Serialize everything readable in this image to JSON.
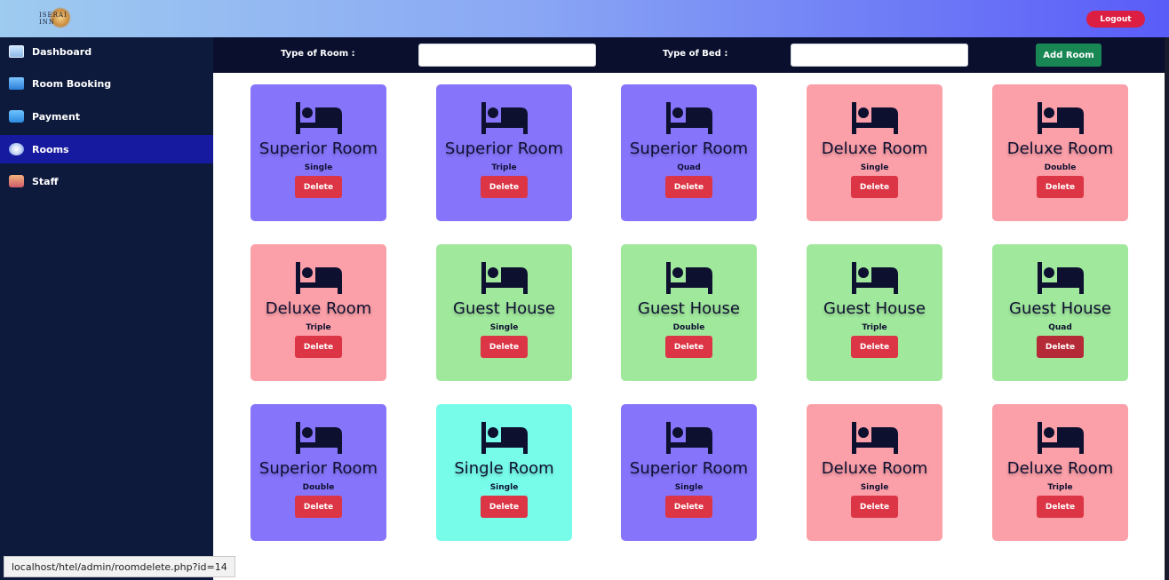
{
  "header": {
    "logo_text": "ISERAI INN",
    "logout_label": "Logout"
  },
  "sidebar": {
    "items": [
      {
        "label": "Dashboard",
        "icon": "monitor-icon"
      },
      {
        "label": "Room Booking",
        "icon": "laptop-icon"
      },
      {
        "label": "Payment",
        "icon": "card-icon"
      },
      {
        "label": "Rooms",
        "icon": "globe-icon",
        "active": true
      },
      {
        "label": "Staff",
        "icon": "people-icon"
      }
    ]
  },
  "filter": {
    "room_type_label": "Type of Room :",
    "room_type_value": "",
    "bed_type_label": "Type of Bed :",
    "bed_type_value": "",
    "add_label": "Add Room"
  },
  "rooms": [
    {
      "name": "Superior Room",
      "bed": "Single",
      "color": "#8675fb"
    },
    {
      "name": "Superior Room",
      "bed": "Triple",
      "color": "#8675fb"
    },
    {
      "name": "Superior Room",
      "bed": "Quad",
      "color": "#8675fb"
    },
    {
      "name": "Deluxe Room",
      "bed": "Single",
      "color": "#fb9fa8"
    },
    {
      "name": "Deluxe Room",
      "bed": "Double",
      "color": "#fb9fa8"
    },
    {
      "name": "Deluxe Room",
      "bed": "Triple",
      "color": "#fb9fa8"
    },
    {
      "name": "Guest House",
      "bed": "Single",
      "color": "#a0e89c"
    },
    {
      "name": "Guest House",
      "bed": "Double",
      "color": "#a0e89c"
    },
    {
      "name": "Guest House",
      "bed": "Triple",
      "color": "#a0e89c"
    },
    {
      "name": "Guest House",
      "bed": "Quad",
      "color": "#a0e89c"
    },
    {
      "name": "Superior Room",
      "bed": "Double",
      "color": "#8675fb"
    },
    {
      "name": "Single Room",
      "bed": "Single",
      "color": "#77fcea"
    },
    {
      "name": "Superior Room",
      "bed": "Single",
      "color": "#8675fb"
    },
    {
      "name": "Deluxe Room",
      "bed": "Single",
      "color": "#fb9fa8"
    },
    {
      "name": "Deluxe Room",
      "bed": "Triple",
      "color": "#fb9fa8"
    }
  ],
  "delete_label": "Delete",
  "status_url": "localhost/htel/admin/roomdelete.php?id=14"
}
